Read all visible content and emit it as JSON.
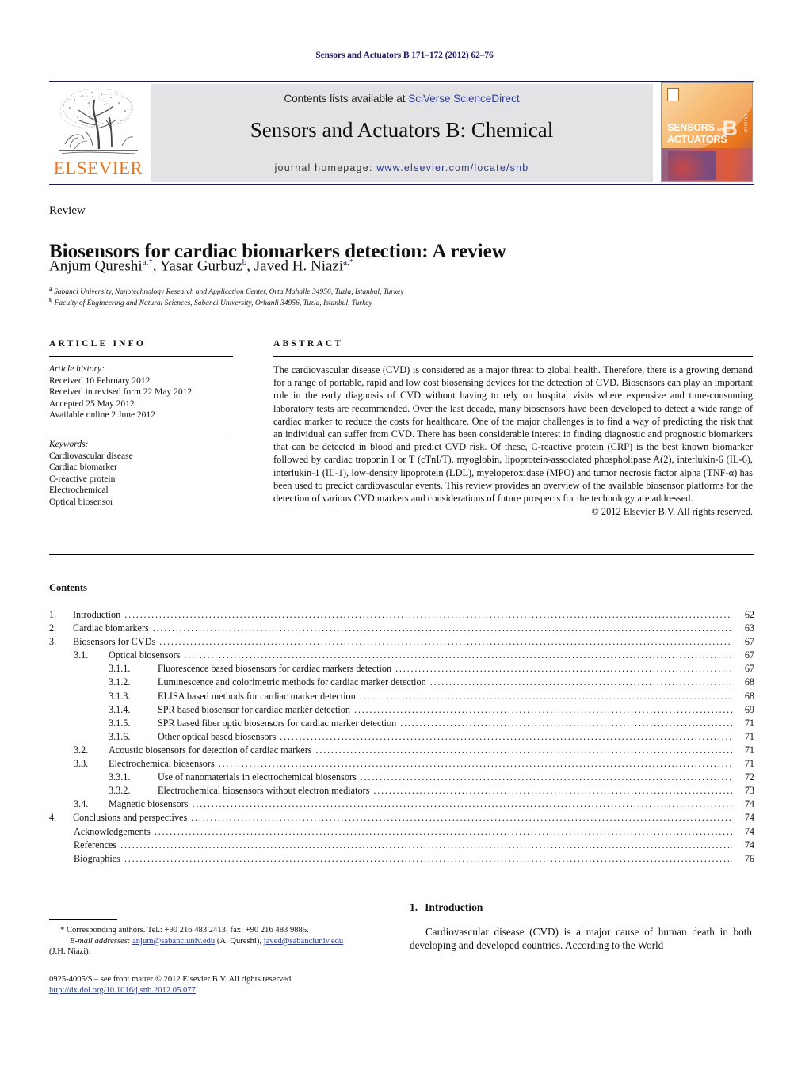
{
  "running_head": "Sensors and Actuators B 171–172 (2012) 62–76",
  "masthead": {
    "contents_prefix": "Contents lists available at ",
    "sciencedirect": "SciVerse ScienceDirect",
    "journal_title": "Sensors and Actuators B: Chemical",
    "homepage_prefix": "journal homepage: ",
    "homepage_url": "www.elsevier.com/locate/snb",
    "publisher": "ELSEVIER",
    "cover": {
      "line1": "SENSORS",
      "and": "and",
      "line2": "ACTUATORS",
      "letter": "B",
      "subtitle": "Chemical"
    },
    "accent_orange": "#e87722",
    "link_blue": "#2b3b8f",
    "rule_navy": "#1a1a5e",
    "panel_grey": "#e3e3e5"
  },
  "article": {
    "doc_type": "Review",
    "title": "Biosensors for cardiac biomarkers detection: A review",
    "authors_html": "Anjum Qureshi<sup>a,*</sup>, Yasar Gurbuz<sup>b</sup>, Javed H. Niazi<sup>a,*</sup>",
    "affiliation_a": "Sabanci University, Nanotechnology Research and Application Center, Orta Mahalle 34956, Tuzla, Istanbul, Turkey",
    "affiliation_b": "Faculty of Engineering and Natural Sciences, Sabanci University, Orhanli 34956, Tuzla, Istanbul, Turkey"
  },
  "info": {
    "heading": "ARTICLE INFO",
    "history_title": "Article history:",
    "history": [
      "Received 10 February 2012",
      "Received in revised form 22 May 2012",
      "Accepted 25 May 2012",
      "Available online 2 June 2012"
    ],
    "keywords_title": "Keywords:",
    "keywords": [
      "Cardiovascular disease",
      "Cardiac biomarker",
      "C-reactive protein",
      "Electrochemical",
      "Optical biosensor"
    ]
  },
  "abstract": {
    "heading": "ABSTRACT",
    "text": "The cardiovascular disease (CVD) is considered as a major threat to global health. Therefore, there is a growing demand for a range of portable, rapid and low cost biosensing devices for the detection of CVD. Biosensors can play an important role in the early diagnosis of CVD without having to rely on hospital visits where expensive and time-consuming laboratory tests are recommended. Over the last decade, many biosensors have been developed to detect a wide range of cardiac marker to reduce the costs for healthcare. One of the major challenges is to find a way of predicting the risk that an individual can suffer from CVD. There has been considerable interest in finding diagnostic and prognostic biomarkers that can be detected in blood and predict CVD risk. Of these, C-reactive protein (CRP) is the best known biomarker followed by cardiac troponin I or T (cTnI/T), myoglobin, lipoprotein-associated phospholipase A(2), interlukin-6 (IL-6), interlukin-1 (IL-1), low-density lipoprotein (LDL), myeloperoxidase (MPO) and tumor necrosis factor alpha (TNF-α) has been used to predict cardiovascular events. This review provides an overview of the available biosensor platforms for the detection of various CVD markers and considerations of future prospects for the technology are addressed.",
    "copyright": "© 2012 Elsevier B.V. All rights reserved."
  },
  "contents": {
    "heading": "Contents",
    "items": [
      {
        "level": 1,
        "num": "1.",
        "label": "Introduction",
        "page": "62"
      },
      {
        "level": 1,
        "num": "2.",
        "label": "Cardiac biomarkers",
        "page": "63"
      },
      {
        "level": 1,
        "num": "3.",
        "label": "Biosensors for CVDs",
        "page": "67"
      },
      {
        "level": 2,
        "num": "3.1.",
        "label": "Optical biosensors",
        "page": "67"
      },
      {
        "level": 3,
        "num": "3.1.1.",
        "label": "Fluorescence based biosensors for cardiac markers detection",
        "page": "67"
      },
      {
        "level": 3,
        "num": "3.1.2.",
        "label": "Luminescence and colorimetric methods for cardiac marker detection",
        "page": "68"
      },
      {
        "level": 3,
        "num": "3.1.3.",
        "label": "ELISA based methods for cardiac marker detection",
        "page": "68"
      },
      {
        "level": 3,
        "num": "3.1.4.",
        "label": "SPR based biosensor for cardiac marker detection",
        "page": "69"
      },
      {
        "level": 3,
        "num": "3.1.5.",
        "label": "SPR based fiber optic biosensors for cardiac marker detection",
        "page": "71"
      },
      {
        "level": 3,
        "num": "3.1.6.",
        "label": "Other optical based biosensors",
        "page": "71"
      },
      {
        "level": 2,
        "num": "3.2.",
        "label": "Acoustic biosensors for detection of cardiac markers",
        "page": "71"
      },
      {
        "level": 2,
        "num": "3.3.",
        "label": "Electrochemical biosensors",
        "page": "71"
      },
      {
        "level": 3,
        "num": "3.3.1.",
        "label": "Use of nanomaterials in electrochemical biosensors",
        "page": "72"
      },
      {
        "level": 3,
        "num": "3.3.2.",
        "label": "Electrochemical biosensors without electron mediators",
        "page": "73"
      },
      {
        "level": 2,
        "num": "3.4.",
        "label": "Magnetic biosensors",
        "page": "74"
      },
      {
        "level": 1,
        "num": "4.",
        "label": "Conclusions and perspectives",
        "page": "74"
      },
      {
        "level": 0,
        "num": "",
        "label": "Acknowledgements",
        "page": "74"
      },
      {
        "level": 0,
        "num": "",
        "label": "References",
        "page": "74"
      },
      {
        "level": 0,
        "num": "",
        "label": "Biographies",
        "page": "76"
      }
    ],
    "dot_leader": "................................................................................................................................................................................................................"
  },
  "footnote": {
    "line1": "* Corresponding authors. Tel.: +90 216 483 2413; fax: +90 216 483 9885.",
    "email_label": "E-mail addresses:",
    "email1": "anjum@sabanciuniv.edu",
    "email1_owner": "(A. Qureshi),",
    "email2": "javed@sabanciuniv.edu",
    "email2_owner": "(J.H. Niazi)."
  },
  "footer": {
    "issn_line": "0925-4005/$ – see front matter © 2012 Elsevier B.V. All rights reserved.",
    "doi": "http://dx.doi.org/10.1016/j.snb.2012.05.077"
  },
  "introduction": {
    "number": "1.",
    "heading": "Introduction",
    "paragraph": "Cardiovascular disease (CVD) is a major cause of human death in both developing and developed countries. According to the World"
  }
}
